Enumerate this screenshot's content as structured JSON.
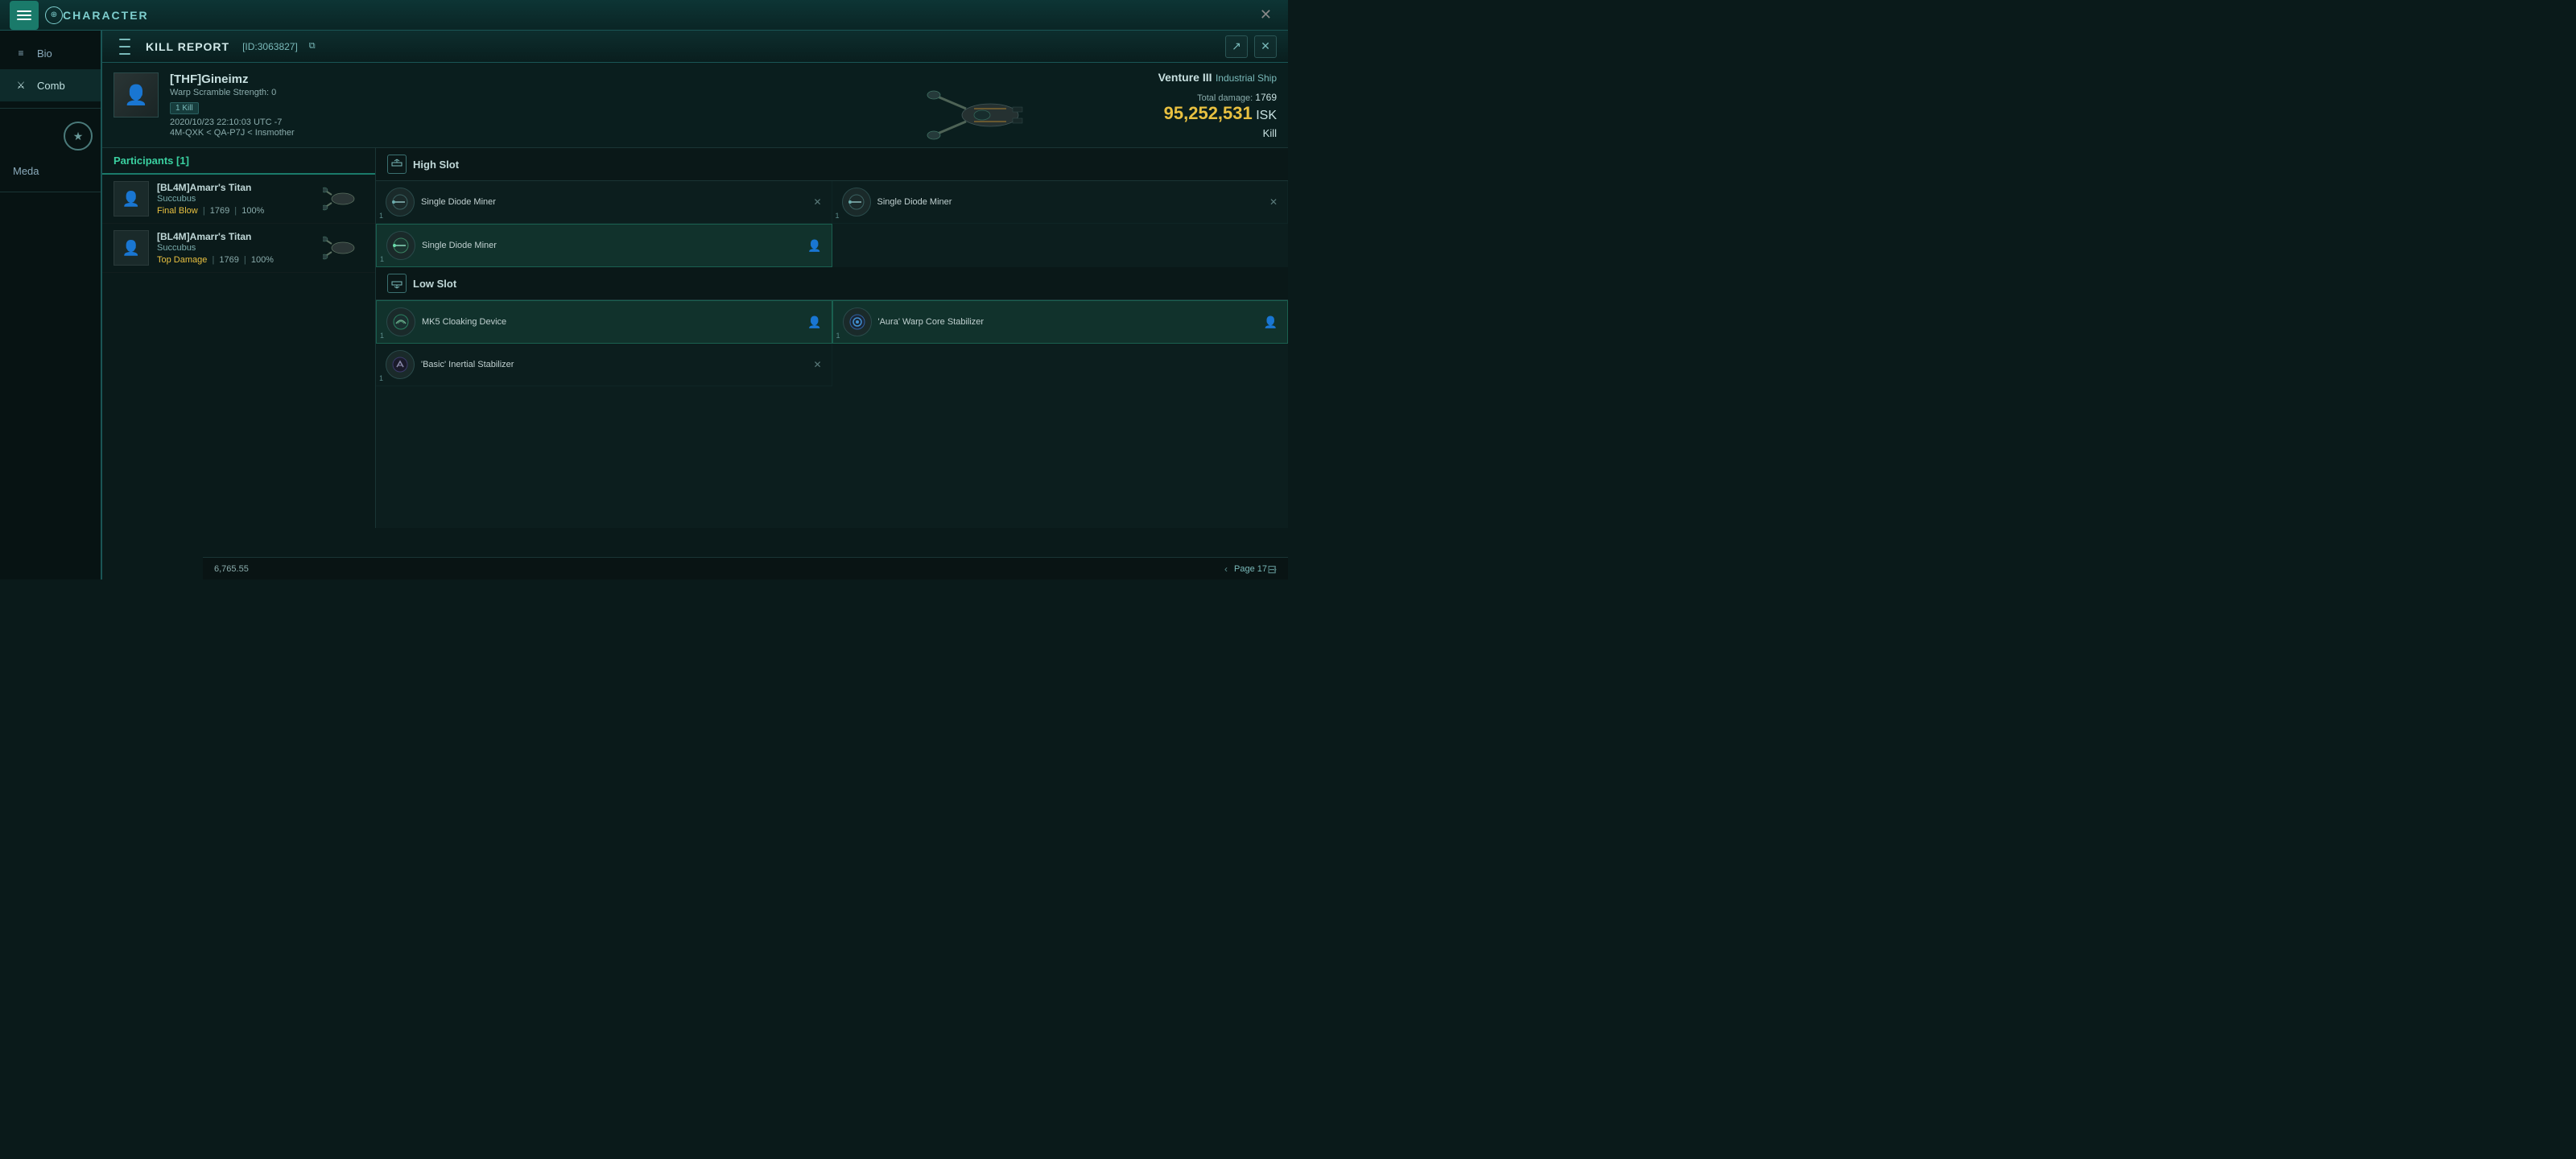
{
  "topbar": {
    "menu_label": "☰",
    "title": "CHARACTER",
    "close_label": "✕"
  },
  "sidebar": {
    "items": [
      {
        "id": "bio",
        "label": "Bio",
        "icon": "≡"
      },
      {
        "id": "combat",
        "label": "Comb",
        "icon": "⚔"
      },
      {
        "id": "medals",
        "label": "Meda",
        "icon": "★"
      }
    ]
  },
  "kill_report": {
    "header": {
      "title": "KILL REPORT",
      "id": "[ID:3063827]",
      "copy_icon": "⧉",
      "export_icon": "↗",
      "close_icon": "✕"
    },
    "victim": {
      "name": "[THF]Gineimz",
      "warp_scramble": "Warp Scramble Strength: 0",
      "kill_count": "1 Kill",
      "timestamp": "2020/10/23 22:10:03 UTC -7",
      "location": "4M-QXK < QA-P7J < Insmother"
    },
    "ship": {
      "name": "Venture III",
      "class": "Industrial Ship",
      "total_damage_label": "Total damage:",
      "total_damage_value": "1769",
      "isk_value": "95,252,531",
      "isk_currency": "ISK",
      "type_label": "Kill"
    },
    "participants": {
      "header": "Participants [1]",
      "items": [
        {
          "name": "[BL4M]Amarr's Titan",
          "ship": "Succubus",
          "badge": "Final Blow",
          "damage": "1769",
          "percent": "100%"
        },
        {
          "name": "[BL4M]Amarr's Titan",
          "ship": "Succubus",
          "badge": "Top Damage",
          "damage": "1769",
          "percent": "100%"
        }
      ]
    },
    "slots": {
      "high_slot": {
        "title": "High Slot",
        "items": [
          {
            "name": "Single Diode Miner",
            "count": "1",
            "status": "normal"
          },
          {
            "name": "Single Diode Miner",
            "count": "1",
            "status": "normal"
          },
          {
            "name": "Single Diode Miner",
            "count": "1",
            "status": "active"
          }
        ]
      },
      "low_slot": {
        "title": "Low Slot",
        "items": [
          {
            "name": "MK5 Cloaking Device",
            "count": "1",
            "status": "active"
          },
          {
            "name": "'Aura' Warp Core Stabilizer",
            "count": "1",
            "status": "active"
          },
          {
            "name": "'Basic' Inertial Stabilizer",
            "count": "1",
            "status": "normal"
          }
        ]
      }
    }
  },
  "bottom": {
    "amount": "6,765.55",
    "page": "Page 17",
    "prev_icon": "‹",
    "next_icon": "›",
    "filter_icon": "⊟"
  }
}
